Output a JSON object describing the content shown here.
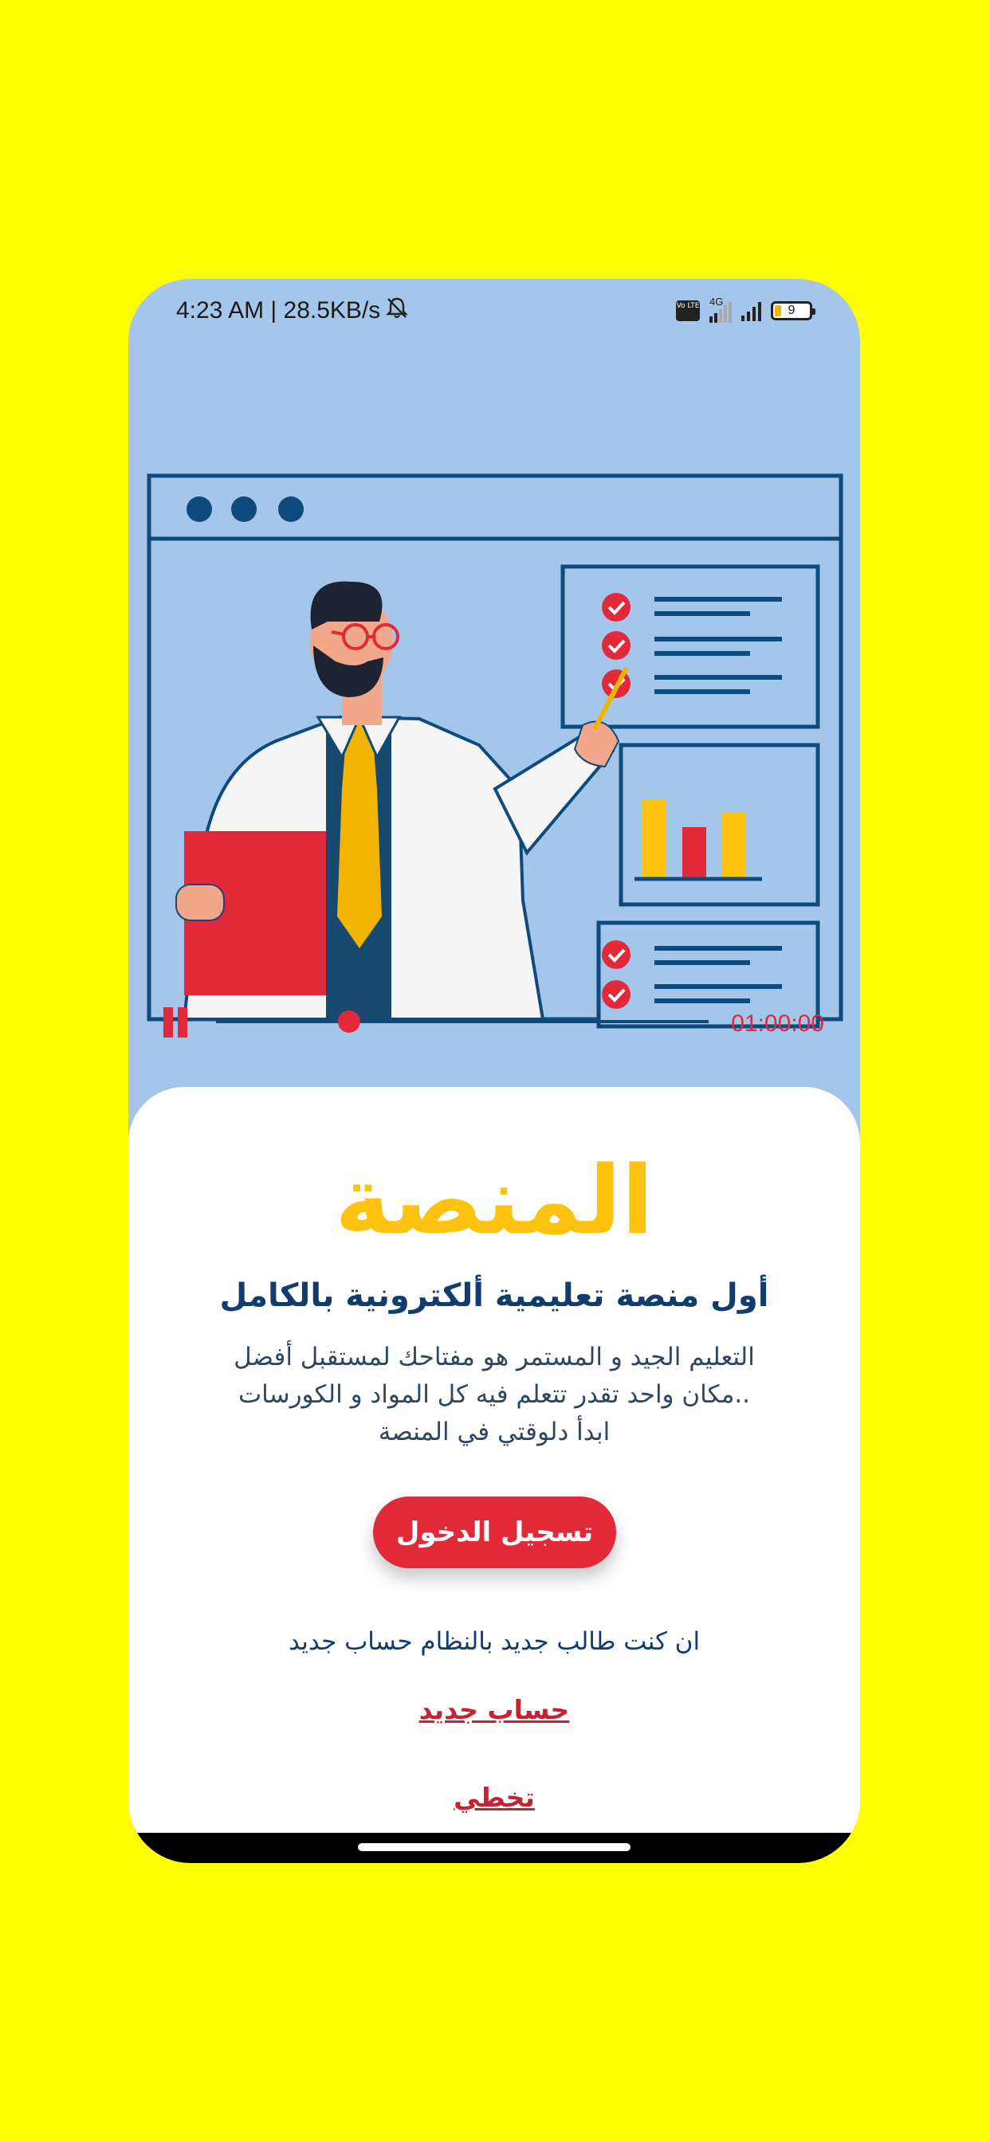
{
  "status_bar": {
    "time_speed": "4:23 AM | 28.5KB/s",
    "mute_icon": "alarm-off-icon",
    "volte": "Vo LTE",
    "network": "4G",
    "battery": "9"
  },
  "video": {
    "timestamp": "01:00:00",
    "progress": 0.27
  },
  "brand": {
    "name": "المنصة"
  },
  "headline": "أول منصة تعليمية ألكترونية بالكامل",
  "description": [
    "التعليم الجيد و المستمر هو مفتاحك لمستقبل أفضل",
    "..مكان واحد تقدر تتعلم فيه كل المواد و الكورسات",
    "ابدأ دلوقتي في المنصة"
  ],
  "actions": {
    "login": "تسجيل الدخول",
    "prompt": "ان كنت طالب جديد بالنظام حساب جديد",
    "new_account": "حساب جديد",
    "skip": "تخطي"
  },
  "colors": {
    "page_bg": "#ffff00",
    "hero_bg": "#a4c6ea",
    "brand": "#ffc20e",
    "accent_red": "#e2293a",
    "navy": "#103d6e"
  }
}
